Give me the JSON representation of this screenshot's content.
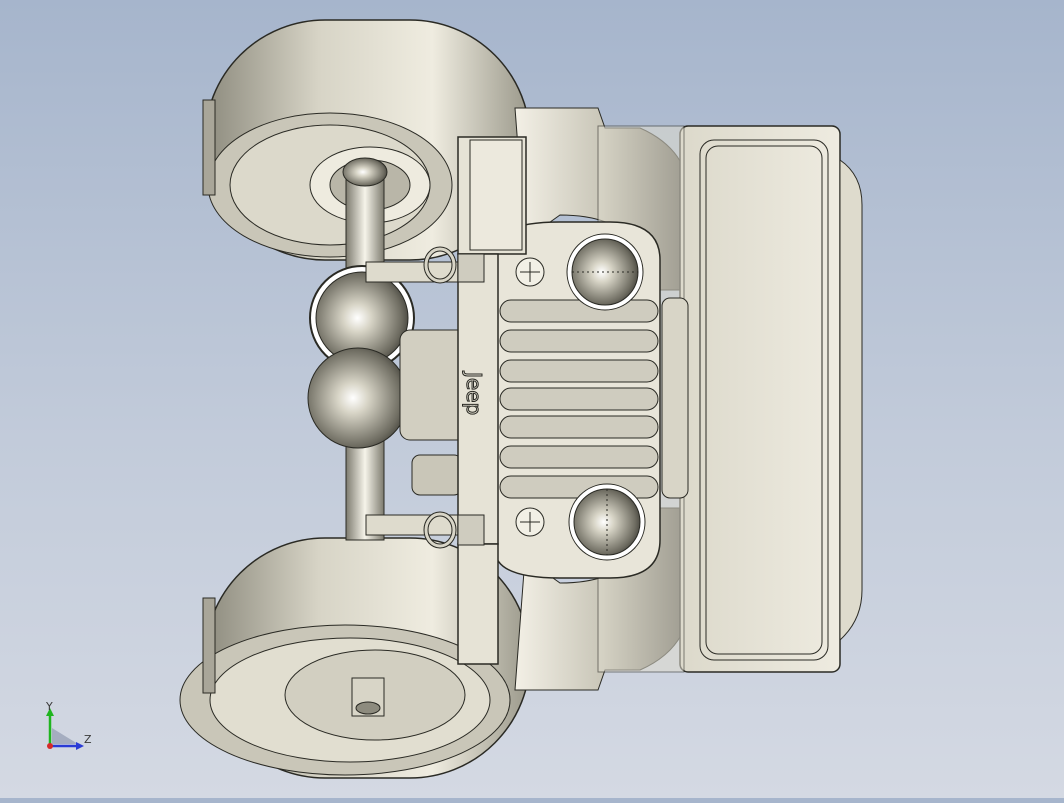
{
  "viewport": {
    "model_name": "Jeep",
    "grille_logo_text": "Jeep",
    "colors": {
      "background_top": "#a6b5cc",
      "background_bottom": "#d4d9e3",
      "model_fill": "#e6e3d6",
      "model_shade": "#8c8a7c",
      "edge_line": "#2a2a24"
    }
  },
  "triad": {
    "y_label": "Y",
    "z_label": "Z",
    "colors": {
      "y_axis": "#1fb51f",
      "z_axis": "#2a3bd6",
      "x_axis": "#d62a2a"
    }
  }
}
